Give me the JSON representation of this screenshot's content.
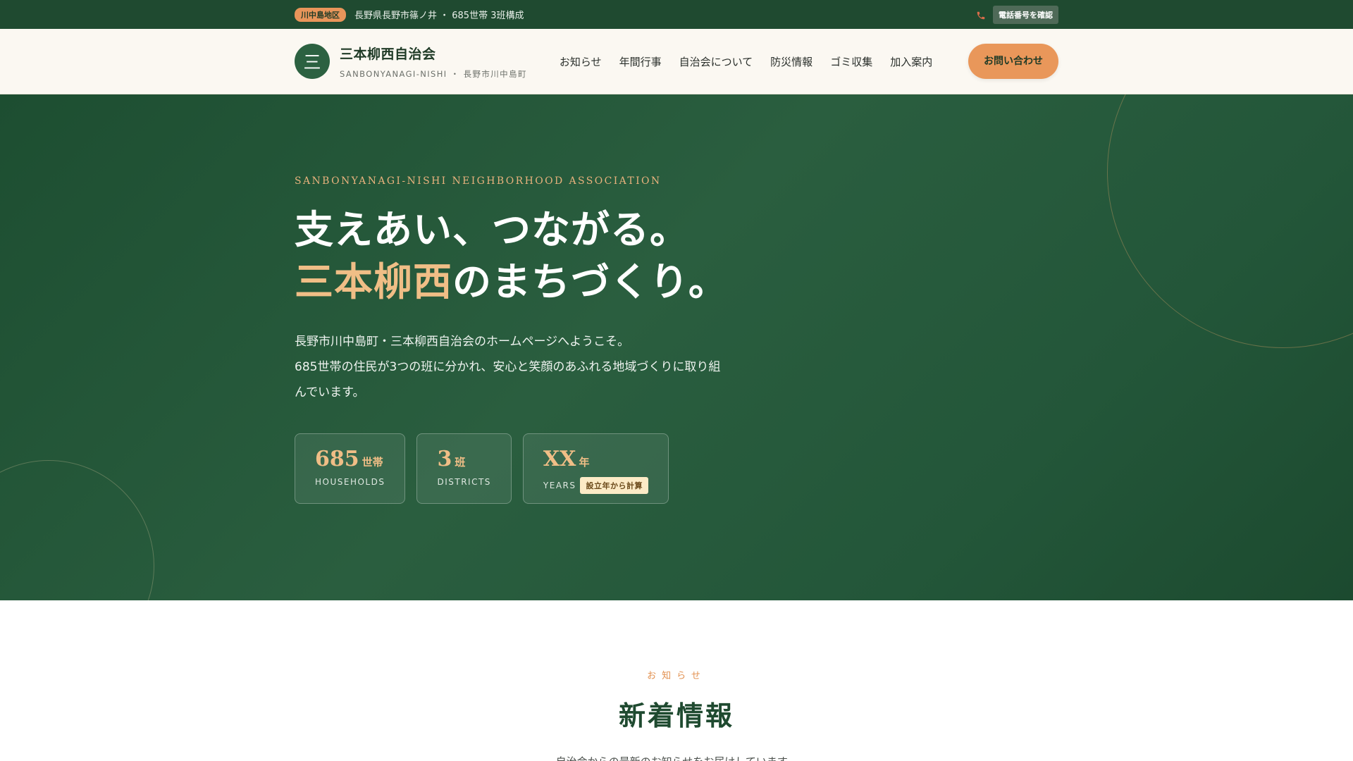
{
  "topbar": {
    "area_badge": "川中島地区",
    "address_info": "長野県長野市篠ノ井 ・ 685世帯 3班構成",
    "phone_icon": "phone-icon",
    "phone_button": "電話番号を確認"
  },
  "header": {
    "logo_char": "三",
    "site_name": "三本柳西自治会",
    "site_sub": "SANBONYANAGI-NISHI ・ 長野市川中島町",
    "nav": [
      "お知らせ",
      "年間行事",
      "自治会について",
      "防災情報",
      "ゴミ収集",
      "加入案内"
    ],
    "cta": "お問い合わせ"
  },
  "hero": {
    "eyebrow": "SANBONYANAGI-NISHI NEIGHBORHOOD ASSOCIATION",
    "headline_line1": "支えあい、つながる。",
    "headline_accent": "三本柳西",
    "headline_line2_rest": "のまちづくり。",
    "lead_line1": "長野市川中島町・三本柳西自治会のホームページへようこそ。",
    "lead_line2": "685世帯の住民が3つの班に分かれ、安心と笑顔のあふれる地域づくりに取り組んでいます。",
    "stats": [
      {
        "num": "685",
        "unit": "世帯",
        "label": "HOUSEHOLDS"
      },
      {
        "num": "3",
        "unit": "班",
        "label": "DISTRICTS"
      },
      {
        "num": "XX",
        "unit": "年",
        "label": "YEARS",
        "badge": "設立年から計算"
      }
    ]
  },
  "news": {
    "kicker": "お知らせ",
    "title": "新着情報",
    "desc": "自治会からの最新のお知らせをお届けしています。"
  },
  "colors": {
    "primary_green": "#1f4a30",
    "accent_orange": "#e9975a",
    "accent_gold": "#f0be86"
  }
}
